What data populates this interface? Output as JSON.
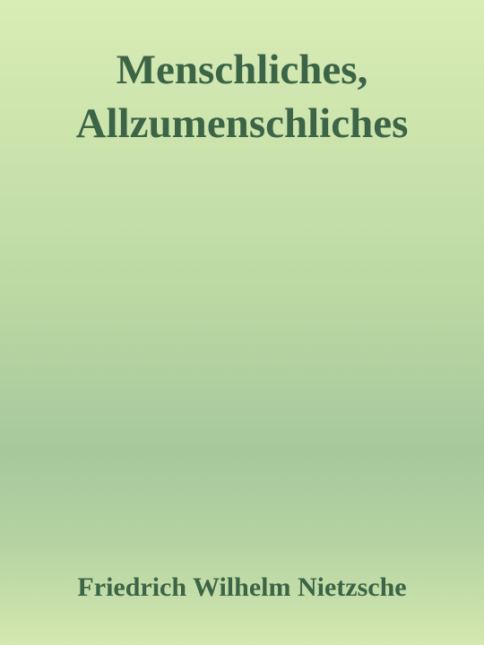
{
  "book": {
    "title_lines": [
      "Menschliches,",
      "Allzumenschliches"
    ],
    "author": "Friedrich Wilhelm Nietzsche"
  },
  "colors": {
    "text": "#3c6446",
    "background_top": "#d8ecb6",
    "background_mid": "#a6c89c",
    "background_bottom": "#d4e8b0"
  }
}
